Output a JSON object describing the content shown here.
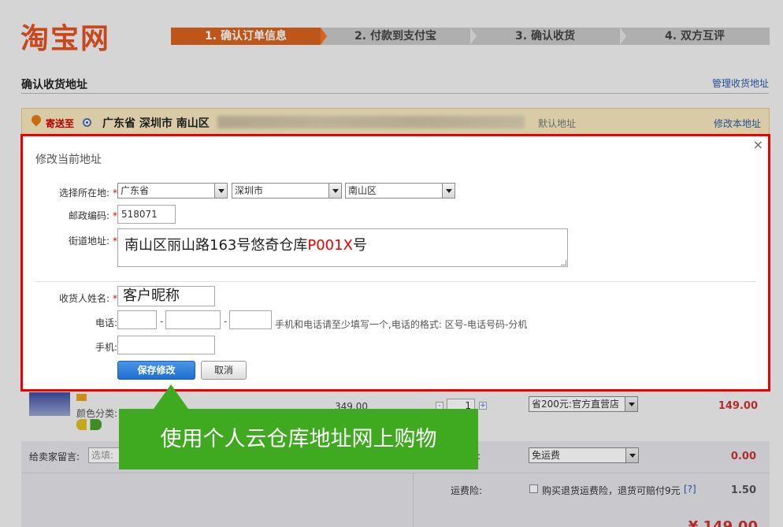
{
  "header": {
    "logo": "淘宝网",
    "steps": [
      "1. 确认订单信息",
      "2. 付款到支付宝",
      "3. 确认收货",
      "4. 双方互评"
    ],
    "active_step": 0
  },
  "section": {
    "title": "确认收货地址",
    "manage_link": "管理收货地址"
  },
  "address_bar": {
    "ship_to": "寄送至",
    "address": "广东省 深圳市 南山区",
    "default_label": "默认地址",
    "modify_link": "修改本地址"
  },
  "dialog": {
    "title": "修改当前地址",
    "close": "×",
    "region_label": "选择所在地:",
    "required_mark": "*",
    "province": "广东省",
    "city": "深圳市",
    "district": "南山区",
    "postcode_label": "邮政编码:",
    "postcode": "518071",
    "street_label": "街道地址:",
    "street_prefix": "南山区丽山路163号悠奇仓库",
    "street_highlight": "P001X",
    "street_suffix": "号",
    "name_label": "收货人姓名:",
    "name_value": "客户昵称",
    "phone_label": "电话:",
    "dash": "-",
    "phone_hint": "手机和电话请至少填写一个,电话的格式: 区号-电话号码-分机",
    "mobile_label": "手机:",
    "save_button": "保存修改",
    "cancel_button": "取消"
  },
  "order": {
    "variant": "颜色分类:",
    "price": "349.00",
    "qty_minus": "-",
    "qty": "1",
    "qty_plus": "+",
    "promo": "省200元:官方直营店",
    "subtotal": "149.00",
    "message_label": "给卖家留言:",
    "message_placeholder": "选填:",
    "colon": ":",
    "shipping": "免运费",
    "shipping_fee": "0.00",
    "insurance_label": "运费险:",
    "insurance_text": "购买退货运费险，退货可赔付9元",
    "insurance_help": "[?]",
    "insurance_fee": "1.50",
    "total_partial": "¥ 149.00"
  },
  "annotation": {
    "text": "使用个人云仓库地址网上购物"
  },
  "colors": {
    "brand": "#e4531f",
    "active_step": "#d7631d",
    "highlight_border": "#ee0000",
    "callout": "#3faa20",
    "link": "#2a5ba8"
  }
}
